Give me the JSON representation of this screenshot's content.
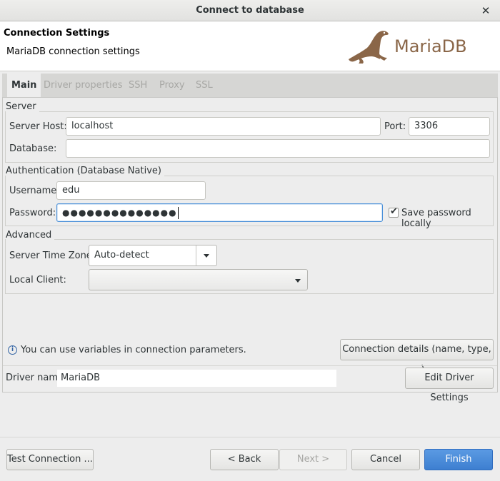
{
  "window": {
    "title": "Connect to database",
    "close_glyph": "✕"
  },
  "header": {
    "title": "Connection Settings",
    "subtitle": "MariaDB connection settings",
    "logo_text": "MariaDB",
    "logo_icon": "sea-lion-logo",
    "brand_color": "#8a6648"
  },
  "tabs": [
    {
      "label": "Main",
      "active": true
    },
    {
      "label": "Driver properties",
      "active": false
    },
    {
      "label": "SSH",
      "active": false
    },
    {
      "label": "Proxy",
      "active": false
    },
    {
      "label": "SSL",
      "active": false
    }
  ],
  "server": {
    "group_label": "Server",
    "host_label": "Server Host:",
    "host_value": "localhost",
    "port_label": "Port:",
    "port_value": "3306",
    "database_label": "Database:",
    "database_value": ""
  },
  "auth": {
    "group_label": "Authentication (Database Native)",
    "username_label": "Username:",
    "username_value": "edu",
    "password_label": "Password:",
    "password_masked": "●●●●●●●●●●●●●●",
    "save_password_label": "Save password locally",
    "save_password_checked": true
  },
  "advanced": {
    "group_label": "Advanced",
    "timezone_label": "Server Time Zone:",
    "timezone_value": "Auto-detect",
    "local_client_label": "Local Client:",
    "local_client_value": ""
  },
  "info": {
    "icon": "info-icon",
    "text": "You can use variables in connection parameters.",
    "connection_details_button": "Connection details (name, type, ... )"
  },
  "driver": {
    "label": "Driver name:",
    "value": "MariaDB",
    "edit_button": "Edit Driver Settings"
  },
  "footer": {
    "test_button": "Test Connection ...",
    "back_button": "< Back",
    "next_button": "Next >",
    "cancel_button": "Cancel",
    "finish_button": "Finish",
    "accent_color": "#3d7fd0"
  }
}
